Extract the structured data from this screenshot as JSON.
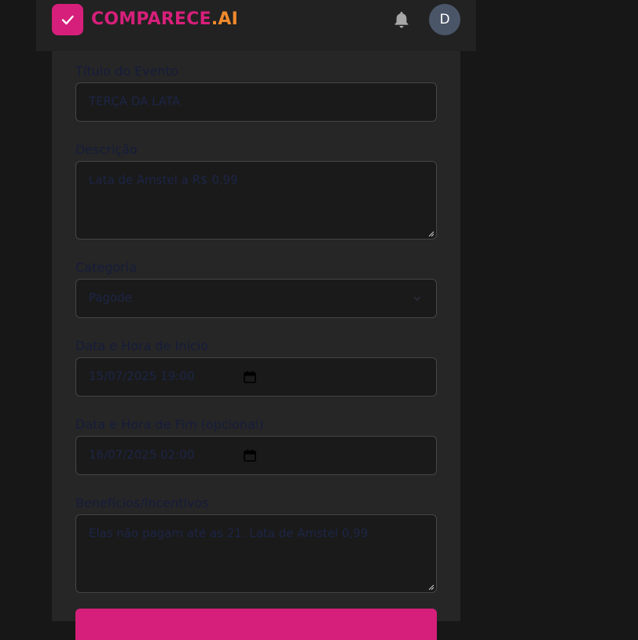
{
  "header": {
    "brand_part1": "COMPARECE",
    "brand_part2": ".AI",
    "avatar_initial": "D",
    "logo_icon": "check-icon",
    "notification_icon": "bell-icon"
  },
  "form": {
    "title_label": "Título do Evento",
    "title_value": "TERÇA DA LATA",
    "description_label": "Descrição",
    "description_value": "Lata de Amstel a R$ 0,99",
    "category_label": "Categoria",
    "category_value": "Pagode",
    "start_label": "Data e Hora de Início",
    "start_value": "15/07/2025  19:00",
    "end_label": "Data e Hora de Fim (opcional)",
    "end_value": "16/07/2025  02:00",
    "benefits_label": "Benefícios/Incentivos",
    "benefits_value": "Elas não pagam até as 21. Lata de Amstel 0,99"
  },
  "colors": {
    "brand_pink": "#d61f7a",
    "brand_orange": "#f08a2b",
    "panel_bg": "#262626",
    "field_bg": "#1a1a1a"
  }
}
